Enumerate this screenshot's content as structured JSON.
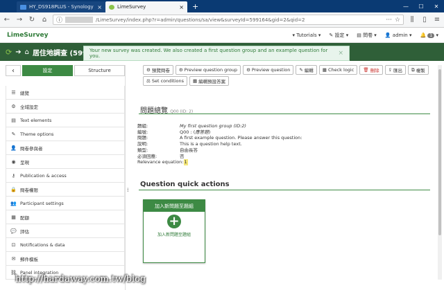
{
  "browser": {
    "tabs": [
      {
        "title": "HY_DS918PLUS - Synology S",
        "close": "×"
      },
      {
        "title": "LimeSurvey",
        "close": "×"
      }
    ],
    "new_tab": "+",
    "url": "/LimeSurvey/index.php?r=admin/questions/sa/view&surveyId=599164&gid=2&qid=2"
  },
  "app": {
    "brand": "LimeSurvey",
    "nav": {
      "tutorials": "Tutorials",
      "settings": "設定",
      "surveys": "問卷",
      "user": "admin",
      "notifications": "1"
    }
  },
  "survey_bar": {
    "title": "居住地調查 (599164"
  },
  "alert": {
    "message": "Your new survey was created. We also created a first question group and an example question for you.",
    "close": "×"
  },
  "sidebar": {
    "tabs": {
      "back": "‹",
      "settings": "設定",
      "structure": "Structure"
    },
    "items": [
      {
        "label": "總覽",
        "icon": "list-icon"
      },
      {
        "label": "全域設定",
        "icon": "cogs-icon"
      },
      {
        "label": "Text elements",
        "icon": "file-text-icon"
      },
      {
        "label": "Theme options",
        "icon": "paint-brush-icon"
      },
      {
        "label": "問卷參與者",
        "icon": "user-icon"
      },
      {
        "label": "呈現",
        "icon": "eye-icon"
      },
      {
        "label": "Publication & access",
        "icon": "key-icon"
      },
      {
        "label": "問卷權限",
        "icon": "lock-icon"
      },
      {
        "label": "Participant settings",
        "icon": "users-icon"
      },
      {
        "label": "配額",
        "icon": "tasks-icon"
      },
      {
        "label": "評估",
        "icon": "comment-icon"
      },
      {
        "label": "Notifications & data",
        "icon": "feed-icon"
      },
      {
        "label": "郵件模板",
        "icon": "envelope-icon"
      },
      {
        "label": "Panel integration",
        "icon": "link-icon"
      }
    ]
  },
  "toolbar": {
    "preview_survey": "預覽問卷",
    "preview_group": "Preview question group",
    "preview_question": "Preview question",
    "edit": "編輯",
    "check_logic": "Check logic",
    "delete": "刪除",
    "export": "匯出",
    "copy": "複製",
    "set_conditions": "Set conditions",
    "edit_default": "編輯預設答案"
  },
  "summary": {
    "title": "問題總覽",
    "qid": "Q00 (ID: 2)",
    "rows": [
      {
        "label": "題組:",
        "value": "My first question group (ID:2)"
      },
      {
        "label": "編號:",
        "value": "Q00 : (",
        "extra": "應答題",
        "tail": ")"
      },
      {
        "label": "問題:",
        "value": "A first example question. Please answer this question:"
      },
      {
        "label": "說明:",
        "value": "This is a question help text."
      },
      {
        "label": "類型:",
        "value": "自由長答"
      },
      {
        "label": "必須回應:",
        "value": "否"
      }
    ],
    "relevance_label": "Relevance equation:",
    "relevance_value": "1"
  },
  "quick_actions": {
    "title": "Question quick actions",
    "panel_header": "加入新問題至題組",
    "panel_label": "加入新問題至題組",
    "plus": "+"
  },
  "watermark": "http://hardaway.com.tw/blog",
  "colors": {
    "tabbar": "#0a3a73",
    "green": "#3d8a44",
    "dark_green": "#2f5f38",
    "alert_bg": "#e8f4ec"
  }
}
